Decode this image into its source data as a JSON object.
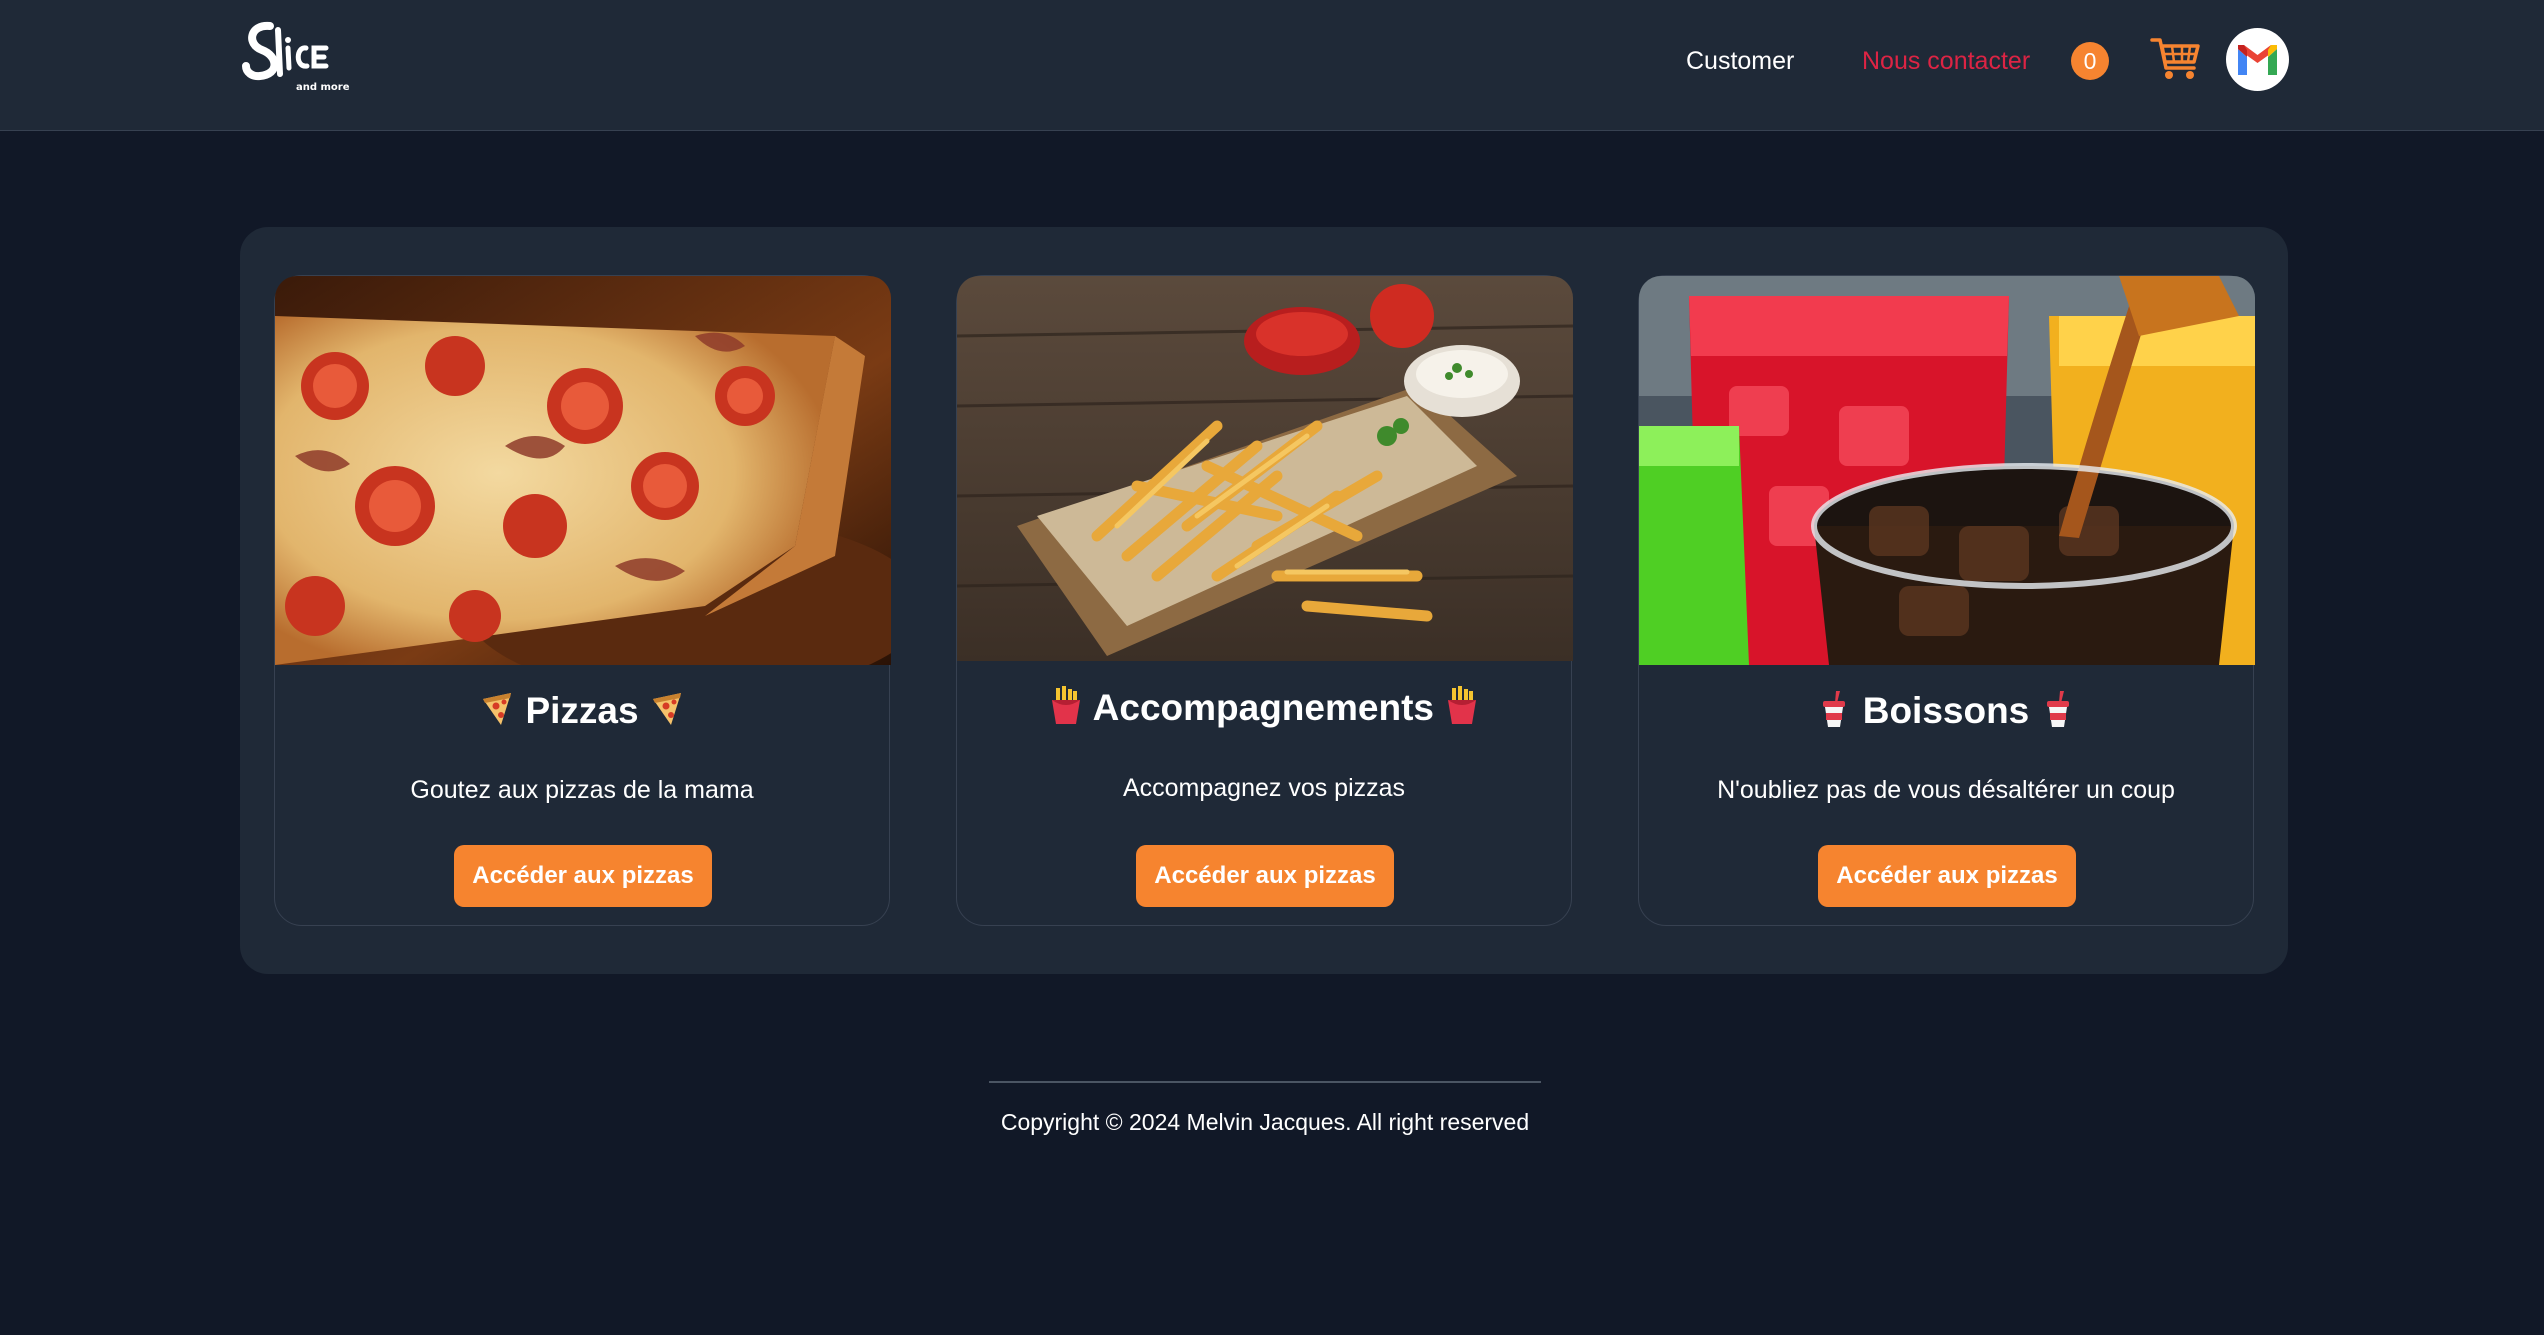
{
  "header": {
    "logo_text": "Slice",
    "logo_tagline": "and more",
    "nav": [
      {
        "label": "Customer"
      },
      {
        "label": "Nous contacter",
        "color": "#dc2444"
      }
    ],
    "cart_count": "0",
    "cart_icon": "shopping-cart-icon",
    "avatar_icon": "gmail-m-icon",
    "accent_color": "#f68430"
  },
  "categories": [
    {
      "title": "Pizzas",
      "emoji": "pizza-slice-icon",
      "description": "Goutez aux pizzas de la mama",
      "button_label": "Accéder aux pizzas",
      "image": "pepperoni pizza slice"
    },
    {
      "title": "Accompagnements",
      "emoji": "french-fries-icon",
      "description": "Accompagnez vos pizzas",
      "button_label": "Accéder aux pizzas",
      "image": "french fries with sauces"
    },
    {
      "title": "Boissons",
      "emoji": "cup-with-straw-icon",
      "description": "N'oubliez pas de vous désaltérer un coup",
      "button_label": "Accéder aux pizzas",
      "image": "colorful soda drinks"
    }
  ],
  "footer": {
    "copyright": "Copyright © 2024 Melvin Jacques. All right reserved"
  }
}
